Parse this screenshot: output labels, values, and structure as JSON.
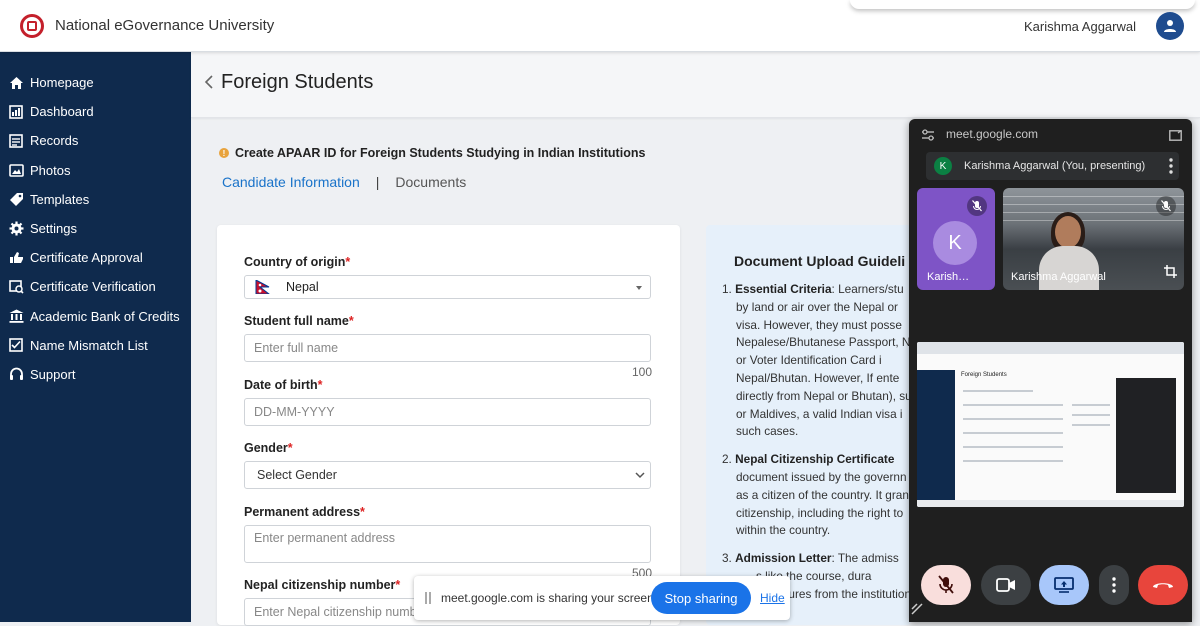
{
  "app": {
    "title": "National eGovernance University",
    "user_name": "Karishma Aggarwal"
  },
  "sidebar": {
    "items": [
      {
        "label": "Homepage",
        "icon": "home-icon"
      },
      {
        "label": "Dashboard",
        "icon": "dashboard-icon"
      },
      {
        "label": "Records",
        "icon": "records-icon"
      },
      {
        "label": "Photos",
        "icon": "photos-icon"
      },
      {
        "label": "Templates",
        "icon": "tag-icon"
      },
      {
        "label": "Settings",
        "icon": "gear-icon"
      },
      {
        "label": "Certificate Approval",
        "icon": "certificate-icon"
      },
      {
        "label": "Certificate Verification",
        "icon": "verification-icon"
      },
      {
        "label": "Academic Bank of Credits",
        "icon": "bank-icon"
      },
      {
        "label": "Name Mismatch List",
        "icon": "list-icon"
      },
      {
        "label": "Support",
        "icon": "headset-icon"
      }
    ]
  },
  "page": {
    "title": "Foreign Students",
    "info": "Create APAAR ID for Foreign Students Studying in Indian Institutions",
    "tabs": {
      "active": "Candidate Information",
      "separator": "|",
      "inactive": "Documents"
    }
  },
  "form": {
    "country": {
      "label": "Country of origin",
      "req": "*",
      "value": "Nepal"
    },
    "full_name": {
      "label": "Student full name",
      "req": "*",
      "placeholder": "Enter full name",
      "counter": "100"
    },
    "dob": {
      "label": "Date of birth",
      "req": "*",
      "placeholder": "DD-MM-YYYY"
    },
    "gender": {
      "label": "Gender",
      "req": "*",
      "value": "Select Gender"
    },
    "address": {
      "label": "Permanent address",
      "req": "*",
      "placeholder": "Enter permanent address",
      "counter": "500"
    },
    "citizenship": {
      "label": "Nepal citizenship number",
      "req": "*",
      "placeholder": "Enter Nepal citizenship numbe"
    }
  },
  "guidelines": {
    "title": "Document Upload Guideli",
    "item1_head": "Essential Criteria",
    "item1_lines": [
      ": Learners/stu",
      "by land or air over the Nepal or",
      "visa. However, they must posse",
      "Nepalese/Bhutanese Passport, N",
      "or Voter Identification Card i",
      "Nepal/Bhutan. However, If ente",
      "directly from Nepal or Bhutan), su",
      "or Maldives, a valid Indian visa i",
      "such cases."
    ],
    "item2_head": "Nepal Citizenship Certificate",
    "item2_lines": [
      "document issued by the governn",
      "as a citizen of the country. It gran",
      "citizenship, including the right to",
      "within the country."
    ],
    "item3_head": "Admission Letter",
    "item3_lines": [
      ": The admiss",
      "s like the course, dura",
      "natures from the institution."
    ],
    "nums": [
      "1.",
      "2.",
      "3."
    ]
  },
  "share_bar": {
    "message": "meet.google.com is sharing your screen.",
    "stop": "Stop sharing",
    "hide": "Hide"
  },
  "meet": {
    "url": "meet.google.com",
    "presenter_initial": "K",
    "presenting": "Karishma Aggarwal (You, presenting)",
    "tile1_initial": "K",
    "tile1_name": "Karish…",
    "tile2_name": "Karishma Aggarwal",
    "mini_title": "Foreign Students"
  },
  "colors": {
    "sidebar": "#0f2a4d",
    "accent": "#1a73c9",
    "meet_bg": "#1f1f1f",
    "tile_purple": "#7e54c6",
    "hangup": "#e8453c"
  }
}
